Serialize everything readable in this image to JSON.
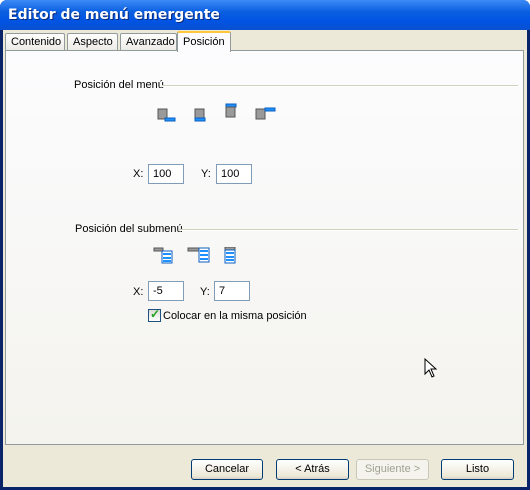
{
  "window": {
    "title": "Editor de menú emergente"
  },
  "tabs": [
    {
      "label": "Contenido",
      "active": false
    },
    {
      "label": "Aspecto",
      "active": false
    },
    {
      "label": "Avanzado",
      "active": false
    },
    {
      "label": "Posición",
      "active": true
    }
  ],
  "menu_position": {
    "group_label": "Posición del menú",
    "icons": [
      "menu-below-left-icon",
      "menu-below-icon",
      "menu-above-icon",
      "menu-right-icon"
    ],
    "x_label": "X:",
    "x_value": "100",
    "y_label": "Y:",
    "y_value": "100"
  },
  "submenu_position": {
    "group_label": "Posición del submenú",
    "icons": [
      "submenu-right-top-icon",
      "submenu-right-aligned-icon",
      "submenu-below-icon"
    ],
    "x_label": "X:",
    "x_value": "-5",
    "y_label": "Y:",
    "y_value": "7",
    "same_position_label": "Colocar en la misma posición",
    "same_position_checked": true
  },
  "buttons": {
    "cancel": "Cancelar",
    "back": "< Atrás",
    "next": "Siguiente >",
    "finish": "Listo"
  },
  "colors": {
    "accent": "#0054e3",
    "icon_blue": "#1e90ff",
    "icon_gray": "#8c8c8c"
  }
}
